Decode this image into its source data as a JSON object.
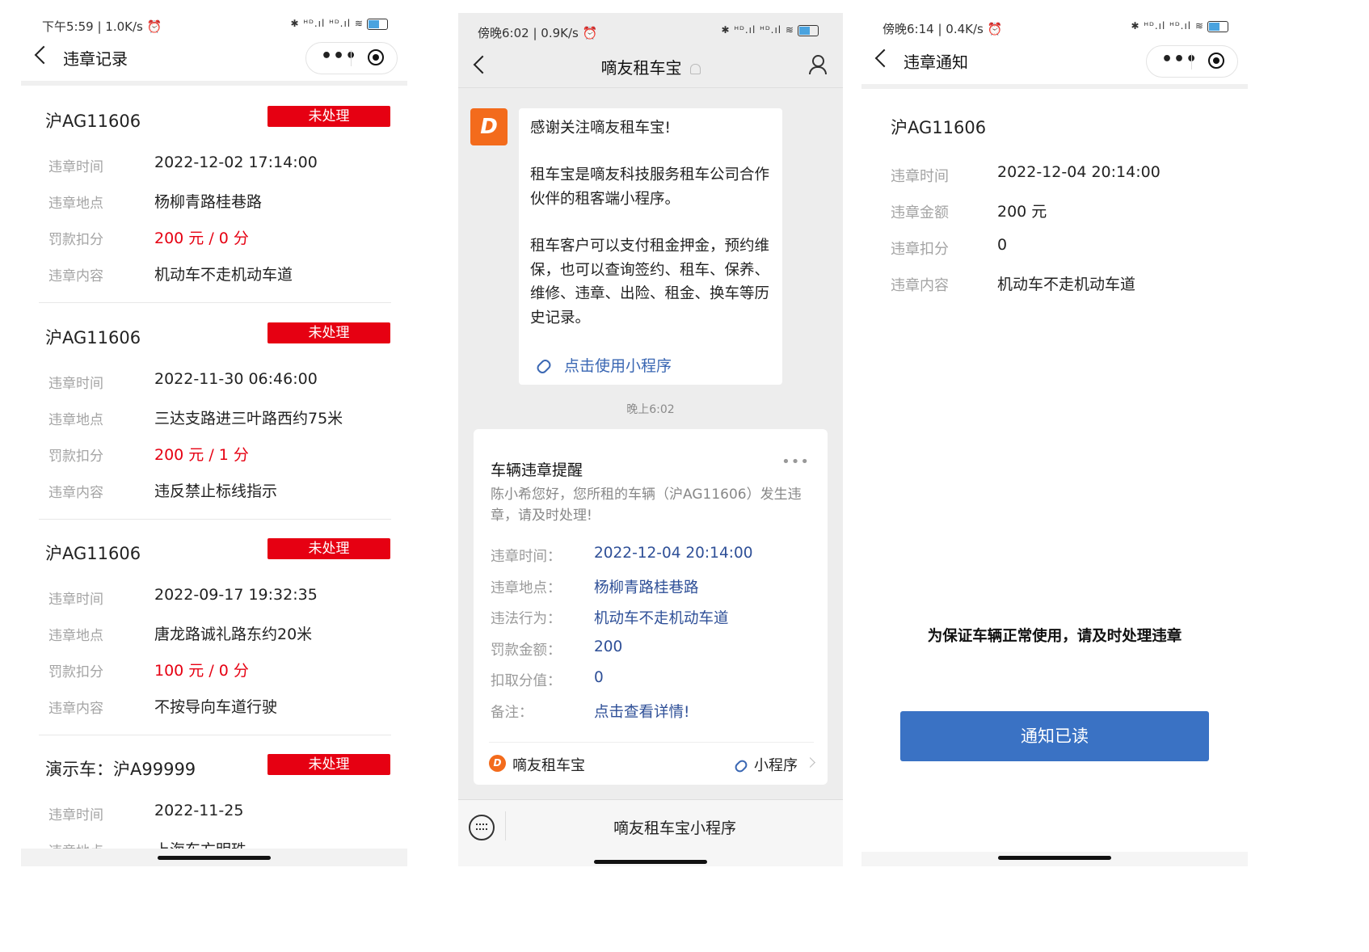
{
  "phone1": {
    "status": {
      "time": "下午5:59 | 1.0K/s ⏰",
      "signal": "✱ ᴴᴰ.ıl ᴴᴰ.ıl ≋",
      "battery": "5"
    },
    "nav_title": "违章记录",
    "records": [
      {
        "plate": "沪AG11606",
        "status": "未处理",
        "fields": [
          {
            "label": "违章时间",
            "value": "2022-12-02 17:14:00"
          },
          {
            "label": "违章地点",
            "value": "杨柳青路桂巷路"
          },
          {
            "label": "罚款扣分",
            "value": "200 元 / 0 分",
            "red": true
          },
          {
            "label": "违章内容",
            "value": "机动车不走机动车道"
          }
        ]
      },
      {
        "plate": "沪AG11606",
        "status": "未处理",
        "fields": [
          {
            "label": "违章时间",
            "value": "2022-11-30 06:46:00"
          },
          {
            "label": "违章地点",
            "value": "三达支路进三叶路西约75米"
          },
          {
            "label": "罚款扣分",
            "value": "200 元 / 1 分",
            "red": true
          },
          {
            "label": "违章内容",
            "value": "违反禁止标线指示"
          }
        ]
      },
      {
        "plate": "沪AG11606",
        "status": "未处理",
        "fields": [
          {
            "label": "违章时间",
            "value": "2022-09-17 19:32:35"
          },
          {
            "label": "违章地点",
            "value": "唐龙路诚礼路东约20米"
          },
          {
            "label": "罚款扣分",
            "value": "100 元 / 0 分",
            "red": true
          },
          {
            "label": "违章内容",
            "value": "不按导向车道行驶"
          }
        ]
      },
      {
        "plate": "演示车：沪A99999",
        "status": "未处理",
        "fields": [
          {
            "label": "违章时间",
            "value": "2022-11-25"
          },
          {
            "label": "违章地点",
            "value": "上海东方明珠"
          }
        ]
      }
    ]
  },
  "phone2": {
    "status": {
      "time": "傍晚6:02 | 0.9K/s ⏰",
      "signal": "✱ ᴴᴰ.ıl ᴴᴰ.ıl ≋",
      "battery": "44"
    },
    "nav_title": "嘀友租车宝",
    "avatar_letter": "D",
    "message": {
      "p1": "感谢关注嘀友租车宝!",
      "p2": "租车宝是嘀友科技服务租车公司合作伙伴的租客端小程序。",
      "p3": "租车客户可以支付租金押金，预约维保，也可以查询签约、租车、保养、维修、违章、出险、租金、换车等历史记录。",
      "link": "点击使用小程序"
    },
    "time": "晚上6:02",
    "card": {
      "title": "车辆违章提醒",
      "more": "•••",
      "desc": "陈小希您好，您所租的车辆（沪AG11606）发生违章，请及时处理!",
      "rows": [
        {
          "label": "违章时间：",
          "value": "2022-12-04 20:14:00"
        },
        {
          "label": "违章地点：",
          "value": "杨柳青路桂巷路"
        },
        {
          "label": "违法行为：",
          "value": "机动车不走机动车道"
        },
        {
          "label": "罚款金额：",
          "value": "200"
        },
        {
          "label": "扣取分值：",
          "value": "0"
        },
        {
          "label": "备注：",
          "value": "点击查看详情!"
        }
      ],
      "footer_name": "嘀友租车宝",
      "footer_link": "小程序",
      "footer_logo": "D"
    },
    "bottom_button": "嘀友租车宝小程序"
  },
  "phone3": {
    "status": {
      "time": "傍晚6:14 | 0.4K/s ⏰",
      "signal": "✱ ᴴᴰ.ıl ᴴᴰ.ıl ≋",
      "battery": "43"
    },
    "nav_title": "违章通知",
    "plate": "沪AG11606",
    "fields": [
      {
        "label": "违章时间",
        "value": "2022-12-04 20:14:00"
      },
      {
        "label": "违章金额",
        "value": "200 元"
      },
      {
        "label": "违章扣分",
        "value": "0"
      },
      {
        "label": "违章内容",
        "value": "机动车不走机动车道"
      }
    ],
    "warning": "为保证车辆正常使用，请及时处理违章",
    "button": "通知已读"
  },
  "colors": {
    "red_badge": "#e60012",
    "blue_button": "#3a72c4",
    "link_blue": "#2e4f97",
    "brand_orange": "#f36b1c"
  },
  "icons": [
    "back-icon",
    "more-dots-icon",
    "target-icon",
    "bell-mute-icon",
    "user-icon",
    "link-icon",
    "keyboard-icon",
    "chevron-right-icon"
  ]
}
